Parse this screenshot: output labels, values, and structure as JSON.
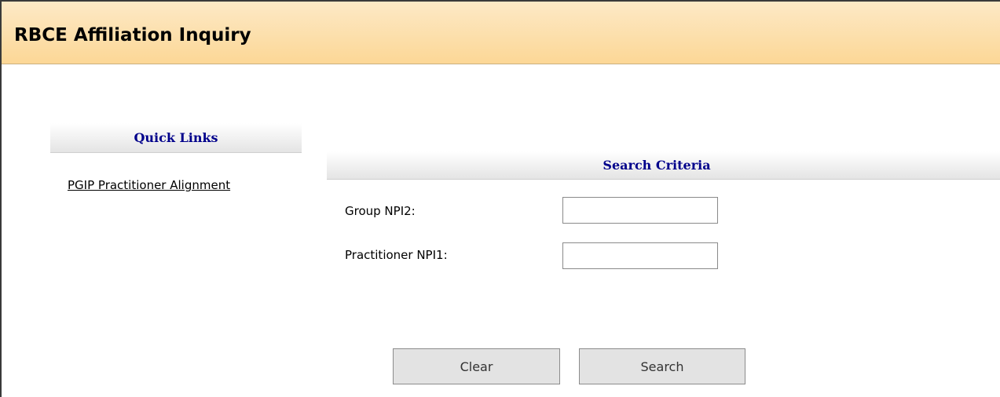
{
  "header": {
    "title": "RBCE Affiliation Inquiry"
  },
  "quick_links": {
    "title": "Quick Links",
    "items": [
      {
        "label": "PGIP Practitioner Alignment"
      }
    ]
  },
  "search_criteria": {
    "title": "Search Criteria",
    "fields": [
      {
        "label": "Group NPI2:",
        "value": "",
        "placeholder": ""
      },
      {
        "label": "Practitioner NPI1:",
        "value": "",
        "placeholder": ""
      }
    ]
  },
  "buttons": {
    "clear_label": "Clear",
    "search_label": "Search"
  },
  "colors": {
    "header_gradient_top": "#fde9c6",
    "header_gradient_bottom": "#fcd796",
    "section_title": "#00008b",
    "button_bg": "#e3e3e3"
  }
}
